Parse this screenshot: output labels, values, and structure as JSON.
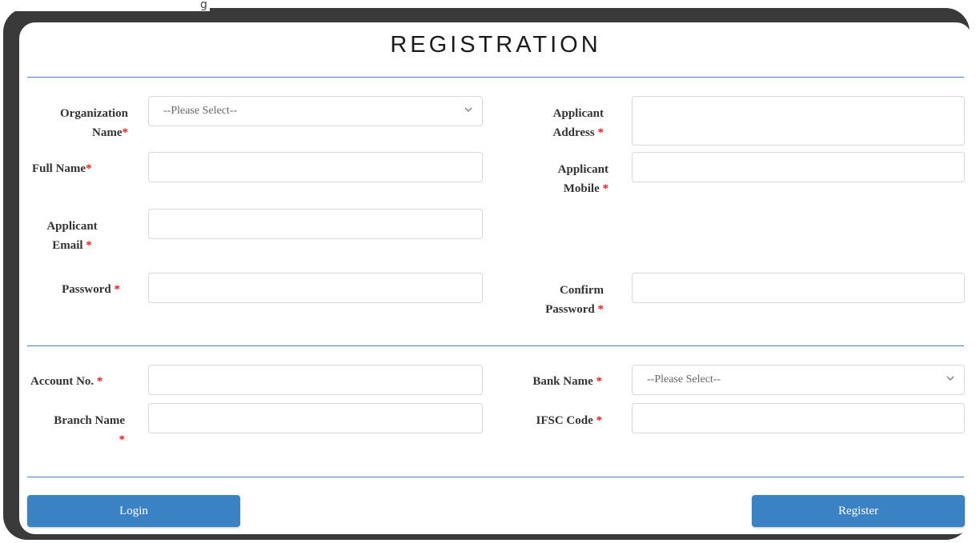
{
  "top_fragment": "g",
  "title": "REGISTRATION",
  "required_mark": "*",
  "org_name": {
    "label_line1": "Organization",
    "label_line2": "Name",
    "placeholder": "--Please Select--"
  },
  "applicant_address": {
    "label_line1": "Applicant",
    "label_line2": "Address"
  },
  "full_name": {
    "label": "Full Name"
  },
  "applicant_mobile": {
    "label_line1": "Applicant",
    "label_line2": "Mobile"
  },
  "applicant_email": {
    "label_line1": "Applicant",
    "label_line2": "Email"
  },
  "password": {
    "label": "Password"
  },
  "confirm_password": {
    "label_line1": "Confirm",
    "label_line2": "Password"
  },
  "account_no": {
    "label": "Account No."
  },
  "bank_name": {
    "label": "Bank Name",
    "placeholder": "--Please Select--"
  },
  "branch_name": {
    "label": "Branch Name"
  },
  "ifsc_code": {
    "label": "IFSC Code"
  },
  "buttons": {
    "login": "Login",
    "register": "Register"
  },
  "icons": {
    "select_arrow": "chevron-down-icon"
  },
  "colors": {
    "accent": "#3b82c4",
    "required": "#e02020",
    "divider": "#4d7bbf"
  }
}
